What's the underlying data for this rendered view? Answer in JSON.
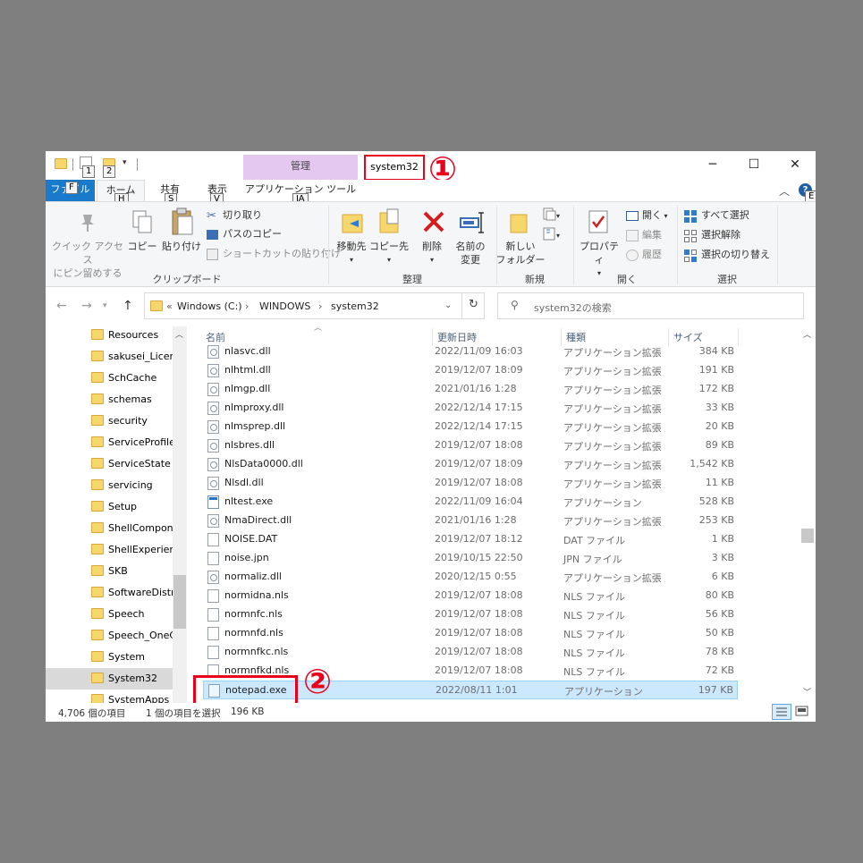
{
  "title_bar": {
    "context_group": "管理",
    "window_title": "system32",
    "keytips": [
      "1",
      "2"
    ],
    "annotation_1": "①",
    "minimize": "─",
    "maximize": "☐",
    "close": "✕"
  },
  "tabs": {
    "file": "ファイル",
    "file_keytip": "F",
    "home": "ホーム",
    "home_keytip": "H",
    "share": "共有",
    "share_keytip": "S",
    "view": "表示",
    "view_keytip": "V",
    "app_tools": "アプリケーション ツール",
    "app_tools_keytip": "JA",
    "help_keytip": "E"
  },
  "ribbon": {
    "clipboard": {
      "pin_line1": "クイック アクセス",
      "pin_line2": "にピン留めする",
      "copy": "コピー",
      "paste": "貼り付け",
      "cut": "切り取り",
      "copy_path": "パスのコピー",
      "paste_shortcut": "ショートカットの貼り付け",
      "label": "クリップボード"
    },
    "organize": {
      "move_to": "移動先",
      "copy_to": "コピー先",
      "delete": "削除",
      "rename_line1": "名前の",
      "rename_line2": "変更",
      "label": "整理"
    },
    "new": {
      "new_folder_line1": "新しい",
      "new_folder_line2": "フォルダー",
      "label": "新規"
    },
    "open": {
      "properties": "プロパティ",
      "open": "開く",
      "edit": "編集",
      "history": "履歴",
      "label": "開く"
    },
    "select": {
      "select_all": "すべて選択",
      "select_none": "選択解除",
      "invert": "選択の切り替え",
      "label": "選択"
    }
  },
  "address_bar": {
    "overflow": "«",
    "crumbs": [
      "Windows (C:)",
      "WINDOWS",
      "system32"
    ],
    "search_placeholder": "system32の検索"
  },
  "nav_pane": {
    "items": [
      "Resources",
      "sakusei_Licen",
      "SchCache",
      "schemas",
      "security",
      "ServiceProfile",
      "ServiceState",
      "servicing",
      "Setup",
      "ShellCompon",
      "ShellExperien",
      "SKB",
      "SoftwareDistr",
      "Speech",
      "Speech_OneC",
      "System",
      "System32",
      "SystemApps"
    ],
    "selected": "System32"
  },
  "file_list": {
    "columns": {
      "name": "名前",
      "date": "更新日時",
      "type": "種類",
      "size": "サイズ"
    },
    "rows": [
      {
        "name": "nlasvc.dll",
        "date": "2022/11/09 16:03",
        "type": "アプリケーション拡張",
        "size": "384 KB",
        "icon": "dll-icon"
      },
      {
        "name": "nlhtml.dll",
        "date": "2019/12/07 18:09",
        "type": "アプリケーション拡張",
        "size": "191 KB",
        "icon": "dll-icon"
      },
      {
        "name": "nlmgp.dll",
        "date": "2021/01/16 1:28",
        "type": "アプリケーション拡張",
        "size": "172 KB",
        "icon": "dll-icon"
      },
      {
        "name": "nlmproxy.dll",
        "date": "2022/12/14 17:15",
        "type": "アプリケーション拡張",
        "size": "33 KB",
        "icon": "dll-icon"
      },
      {
        "name": "nlmsprep.dll",
        "date": "2022/12/14 17:15",
        "type": "アプリケーション拡張",
        "size": "20 KB",
        "icon": "dll-icon"
      },
      {
        "name": "nlsbres.dll",
        "date": "2019/12/07 18:08",
        "type": "アプリケーション拡張",
        "size": "89 KB",
        "icon": "dll-icon"
      },
      {
        "name": "NlsData0000.dll",
        "date": "2019/12/07 18:09",
        "type": "アプリケーション拡張",
        "size": "1,542 KB",
        "icon": "dll-icon"
      },
      {
        "name": "Nlsdl.dll",
        "date": "2019/12/07 18:08",
        "type": "アプリケーション拡張",
        "size": "11 KB",
        "icon": "dll-icon"
      },
      {
        "name": "nltest.exe",
        "date": "2022/11/09 16:04",
        "type": "アプリケーション",
        "size": "528 KB",
        "icon": "exe-icon"
      },
      {
        "name": "NmaDirect.dll",
        "date": "2021/01/16 1:28",
        "type": "アプリケーション拡張",
        "size": "253 KB",
        "icon": "dll-icon"
      },
      {
        "name": "NOISE.DAT",
        "date": "2019/12/07 18:12",
        "type": "DAT ファイル",
        "size": "1 KB",
        "icon": "file-icon"
      },
      {
        "name": "noise.jpn",
        "date": "2019/10/15 22:50",
        "type": "JPN ファイル",
        "size": "3 KB",
        "icon": "file-icon"
      },
      {
        "name": "normaliz.dll",
        "date": "2020/12/15 0:55",
        "type": "アプリケーション拡張",
        "size": "6 KB",
        "icon": "dll-icon"
      },
      {
        "name": "normidna.nls",
        "date": "2019/12/07 18:08",
        "type": "NLS ファイル",
        "size": "80 KB",
        "icon": "file-icon"
      },
      {
        "name": "normnfc.nls",
        "date": "2019/12/07 18:08",
        "type": "NLS ファイル",
        "size": "56 KB",
        "icon": "file-icon"
      },
      {
        "name": "normnfd.nls",
        "date": "2019/12/07 18:08",
        "type": "NLS ファイル",
        "size": "50 KB",
        "icon": "file-icon"
      },
      {
        "name": "normnfkc.nls",
        "date": "2019/12/07 18:08",
        "type": "NLS ファイル",
        "size": "78 KB",
        "icon": "file-icon"
      },
      {
        "name": "normnfkd.nls",
        "date": "2019/12/07 18:08",
        "type": "NLS ファイル",
        "size": "72 KB",
        "icon": "file-icon"
      },
      {
        "name": "notepad.exe",
        "date": "2022/08/11 1:01",
        "type": "アプリケーション",
        "size": "197 KB",
        "icon": "notepad-icon",
        "selected": true
      }
    ],
    "annotation_2": "②"
  },
  "status_bar": {
    "item_count": "4,706 個の項目",
    "selection": "1 個の項目を選択",
    "selection_size": "196 KB"
  },
  "colors": {
    "file_tab": "#1979ca",
    "context_tab": "#e4c8f0",
    "selection": "#cce8ff",
    "annotation": "#e8001c"
  }
}
